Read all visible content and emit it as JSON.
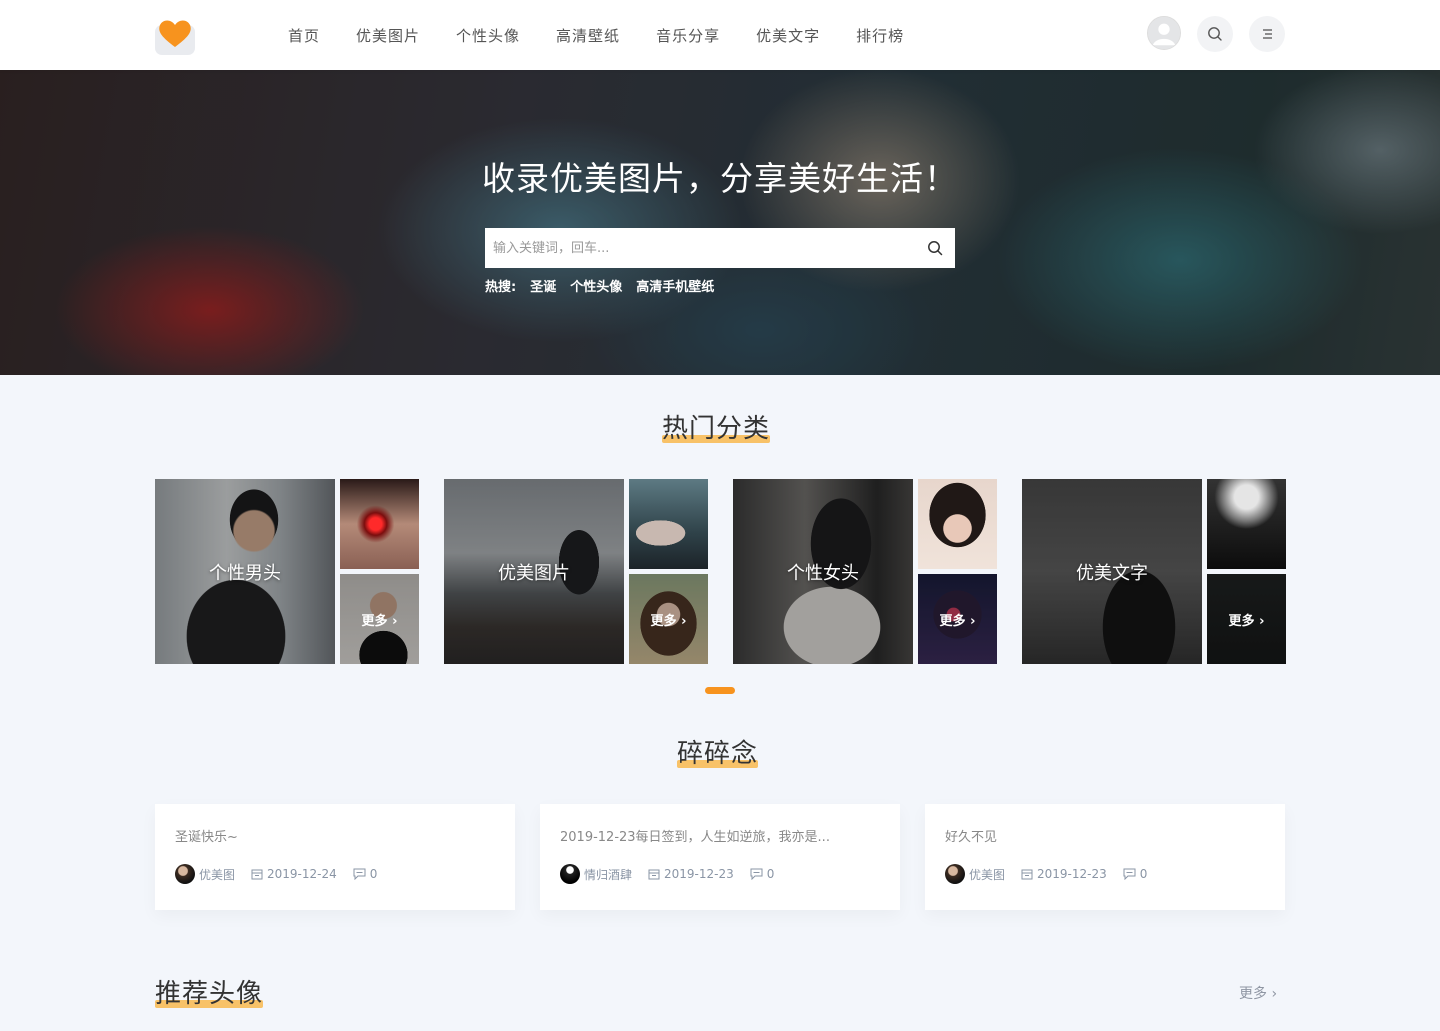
{
  "colors": {
    "accent": "#f7931e",
    "highlight": "#f8b84e",
    "background": "#f3f6fb"
  },
  "nav": {
    "items": [
      "首页",
      "优美图片",
      "个性头像",
      "高清壁纸",
      "音乐分享",
      "优美文字",
      "排行榜"
    ]
  },
  "header_icons": [
    "user-avatar-icon",
    "search-icon",
    "menu-icon"
  ],
  "hero": {
    "title": "收录优美图片，分享美好生活！",
    "search_placeholder": "输入关键词，回车...",
    "hot_label": "热搜:",
    "hot_tags": [
      "圣诞",
      "个性头像",
      "高清手机壁纸"
    ]
  },
  "section_hot": {
    "title": "热门分类"
  },
  "categories": [
    {
      "label": "个性男头",
      "more": "更多"
    },
    {
      "label": "优美图片",
      "more": "更多"
    },
    {
      "label": "个性女头",
      "more": "更多"
    },
    {
      "label": "优美文字",
      "more": "更多"
    }
  ],
  "section_moments": {
    "title": "碎碎念"
  },
  "moments": [
    {
      "title": "圣诞快乐~",
      "author": "优美图",
      "date": "2019-12-24",
      "comments": "0"
    },
    {
      "title": "2019-12-23每日签到，人生如逆旅，我亦是...",
      "author": "情归酒肆",
      "date": "2019-12-23",
      "comments": "0"
    },
    {
      "title": "好久不见",
      "author": "优美图",
      "date": "2019-12-23",
      "comments": "0"
    }
  ],
  "section_avatars": {
    "title": "推荐头像",
    "more": "更多"
  }
}
